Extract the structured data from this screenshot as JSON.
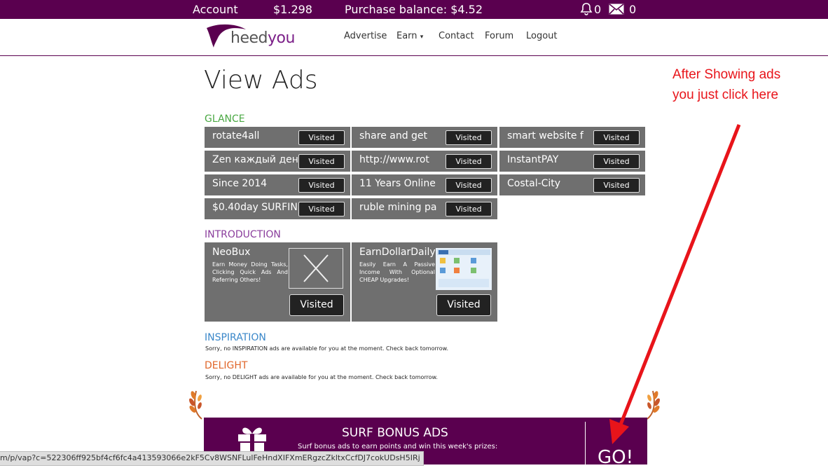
{
  "topbar": {
    "account_label": "Account",
    "account_value": "$1.298",
    "purchase_balance": "Purchase balance: $4.52",
    "notifications_count": "0",
    "messages_count": "0"
  },
  "nav": {
    "logo_a": "heed",
    "logo_b": "you",
    "links": [
      "Advertise",
      "Earn",
      "Contact",
      "Forum",
      "Logout"
    ],
    "earn_caret": "▾"
  },
  "page_title": "View Ads",
  "glance": {
    "title": "GLANCE",
    "ads": [
      {
        "name": "rotate4all",
        "status": "Visited"
      },
      {
        "name": "share and get",
        "status": "Visited"
      },
      {
        "name": "smart website f",
        "status": "Visited"
      },
      {
        "name": "Zen каждый день",
        "status": "Visited"
      },
      {
        "name": "http://www.rot",
        "status": "Visited"
      },
      {
        "name": "InstantPAY",
        "status": "Visited"
      },
      {
        "name": "Since 2014",
        "status": "Visited"
      },
      {
        "name": "11 Years Online",
        "status": "Visited"
      },
      {
        "name": "Costal-City",
        "status": "Visited"
      },
      {
        "name": "$0.40day SURFIN",
        "status": "Visited"
      },
      {
        "name": "ruble mining pa",
        "status": "Visited"
      }
    ]
  },
  "introduction": {
    "title": "INTRODUCTION",
    "ads": [
      {
        "name": "NeoBux",
        "desc": "Earn Money Doing Tasks, Clicking Quick Ads And Referring Others!",
        "status": "Visited"
      },
      {
        "name": "EarnDollarDaily",
        "desc": "Easily Earn A Passive Income With Optional CHEAP Upgrades!",
        "status": "Visited"
      }
    ]
  },
  "inspiration": {
    "title": "INSPIRATION",
    "message": "Sorry, no INSPIRATION ads are available for you at the moment. Check back tomorrow."
  },
  "delight": {
    "title": "DELIGHT",
    "message": "Sorry, no DELIGHT ads are available for you at the moment. Check back tomorrow."
  },
  "bonus": {
    "title": "SURF BONUS ADS",
    "subtitle": "Surf bonus ads to earn points and win this week's prizes:",
    "go_label": "GO!"
  },
  "annotation": {
    "line1": "After Showing ads",
    "line2": "you just click here"
  },
  "statusbar_url": "m/p/vap?c=522306ff925bf4cf6fc4a413593066e2kF5Cv8WSNFLulFeHndXIFXmERgzcZkltxCcfDJ7cokUDsH5IRj",
  "colors": {
    "brand_purple": "#5a004f",
    "glance": "#4aa843",
    "introduction": "#8a3d9c",
    "inspiration": "#3a87c9",
    "delight": "#e0662a",
    "annotation": "#e8141a",
    "cell_bg": "#6f6f6f"
  },
  "icons": [
    "bell-icon",
    "envelope-icon",
    "gift-icon",
    "laurel-icon",
    "broken-image-icon"
  ]
}
